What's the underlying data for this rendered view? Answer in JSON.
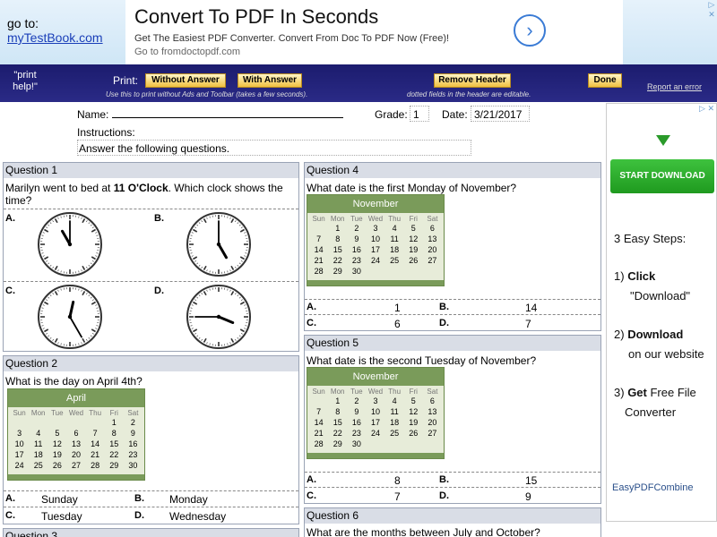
{
  "banner": {
    "goto_line1": "go to:",
    "goto_link": "myTestBook.com"
  },
  "ad_top": {
    "title": "Convert To PDF In Seconds",
    "subtitle": "Get The Easiest PDF Converter. Convert From Doc To PDF Now (Free)!",
    "url": "Go to fromdoctopdf.com",
    "arrow": "›",
    "marks": "▷ ✕"
  },
  "toolbar": {
    "print_help": "\"print help!\"",
    "print_label": "Print:",
    "without_answer": "Without Answer",
    "with_answer": "With Answer",
    "remove_header": "Remove Header",
    "done": "Done",
    "report": "Report an error",
    "hint1": "Use this to print without Ads and Toolbar (takes a few seconds).",
    "hint2": "dotted fields in the header are editable."
  },
  "header": {
    "name_label": "Name:",
    "grade_label": "Grade:",
    "grade_value": "1",
    "date_label": "Date:",
    "date_value": "3/21/2017",
    "instructions_label": "Instructions:",
    "instructions_text": "Answer the following questions."
  },
  "q1": {
    "title": "Question 1",
    "text_pre": "Marilyn went to bed at ",
    "text_bold": "11 O'Clock",
    "text_post": ". Which clock shows the time?",
    "a": "A.",
    "b": "B.",
    "c": "C.",
    "d": "D."
  },
  "q2": {
    "title": "Question 2",
    "text": "What is the day on April 4th?",
    "month": "April",
    "a": "A.",
    "a_val": "Sunday",
    "b": "B.",
    "b_val": "Monday",
    "c": "C.",
    "c_val": "Tuesday",
    "d": "D.",
    "d_val": "Wednesday"
  },
  "q3": {
    "title": "Question 3"
  },
  "q4": {
    "title": "Question 4",
    "text": "What date is the first Monday of November?",
    "month": "November",
    "a": "A.",
    "a_val": "1",
    "b": "B.",
    "b_val": "14",
    "c": "C.",
    "c_val": "6",
    "d": "D.",
    "d_val": "7"
  },
  "q5": {
    "title": "Question 5",
    "text": "What date is the second Tuesday of November?",
    "month": "November",
    "a": "A.",
    "a_val": "8",
    "b": "B.",
    "b_val": "15",
    "c": "C.",
    "c_val": "7",
    "d": "D.",
    "d_val": "9"
  },
  "q6": {
    "title": "Question 6",
    "text": "What are the months between July and October?"
  },
  "weekdays": [
    "Sun",
    "Mon",
    "Tue",
    "Wed",
    "Thu",
    "Fri",
    "Sat"
  ],
  "april_days": [
    "",
    "",
    "",
    "",
    "",
    "1",
    "2",
    "3",
    "4",
    "5",
    "6",
    "7",
    "8",
    "9",
    "10",
    "11",
    "12",
    "13",
    "14",
    "15",
    "16",
    "17",
    "18",
    "19",
    "20",
    "21",
    "22",
    "23",
    "24",
    "25",
    "26",
    "27",
    "28",
    "29",
    "30"
  ],
  "november_days": [
    "",
    "1",
    "2",
    "3",
    "4",
    "5",
    "6",
    "7",
    "8",
    "9",
    "10",
    "11",
    "12",
    "13",
    "14",
    "15",
    "16",
    "17",
    "18",
    "19",
    "20",
    "21",
    "22",
    "23",
    "24",
    "25",
    "26",
    "27",
    "28",
    "29",
    "30"
  ],
  "ad_right": {
    "marks": "▷ ✕",
    "button": "START DOWNLOAD",
    "steps_title": "3 Easy Steps:",
    "s1_num": "1)",
    "s1_bold": "Click",
    "s1_rest": "\"Download\"",
    "s2_num": "2)",
    "s2_bold": "Download",
    "s2_rest": "on our website",
    "s3_num": "3)",
    "s3_bold": "Get",
    "s3_rest1": "Free File",
    "s3_rest2": "Converter",
    "brand": "EasyPDFCombine"
  },
  "clocks": [
    {
      "hour": 11,
      "minute": 0
    },
    {
      "hour": 5,
      "minute": 0
    },
    {
      "hour": 12,
      "minute": 25
    },
    {
      "hour": 3,
      "minute": 45
    }
  ],
  "colors": {
    "toolbar": "#1c1c6e",
    "button": "#f0c040",
    "calendar_header": "#7a9b5a",
    "download": "#2a9a2a",
    "link": "#1a3fb8"
  }
}
